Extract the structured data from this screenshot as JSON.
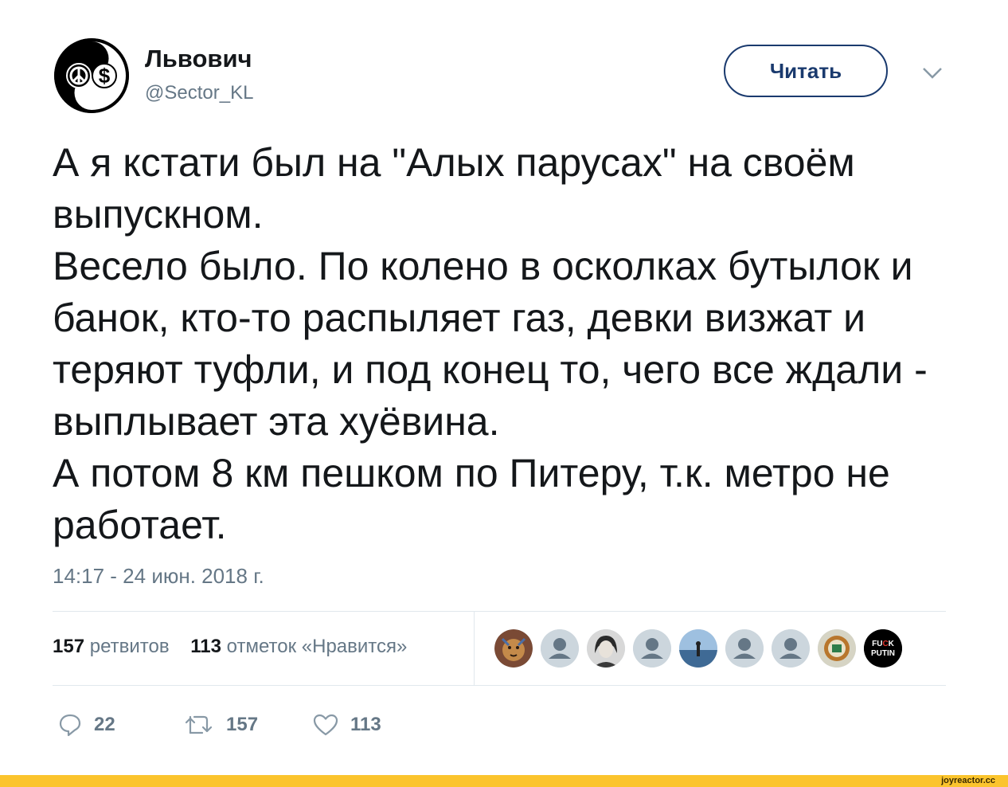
{
  "author": {
    "name": "Львович",
    "handle": "@Sector_KL",
    "avatar_icon": "peace-dollar-yinyang-icon"
  },
  "follow_button": {
    "label": "Читать"
  },
  "menu_icon": "chevron-down-icon",
  "tweet": {
    "paragraphs": [
      "А я кстати был на \"Алых парусах\" на своём выпускном.",
      "Весело было. По колено в осколках бутылок и банок, кто-то распыляет газ, девки визжат и теряют туфли, и под конец то, чего все ждали - выплывает эта хуёвина.",
      "А потом 8 км пешком по Питеру, т.к. метро не работает."
    ],
    "timestamp": "14:17 - 24 июн. 2018 г."
  },
  "stats": {
    "retweets_count": "157",
    "retweets_label": "ретвитов",
    "likes_count": "113",
    "likes_label": "отметок «Нравится»"
  },
  "likers": [
    {
      "icon": "lion-avatar",
      "color": "#8a5a3c"
    },
    {
      "icon": "default-user-avatar",
      "color": "#ccd6dd"
    },
    {
      "icon": "portrait-avatar",
      "color": "#6b6b6b"
    },
    {
      "icon": "default-user-avatar",
      "color": "#ccd6dd"
    },
    {
      "icon": "seascape-avatar",
      "color": "#5a7fa8"
    },
    {
      "icon": "default-user-avatar",
      "color": "#ccd6dd"
    },
    {
      "icon": "default-user-avatar",
      "color": "#ccd6dd"
    },
    {
      "icon": "badge-avatar",
      "color": "#c9c9b8"
    },
    {
      "icon": "fuck-putin-avatar",
      "color": "#000000",
      "text": "FUCK PUTIN"
    }
  ],
  "actions": {
    "reply_count": "22",
    "retweet_count": "157",
    "like_count": "113"
  },
  "footer": {
    "brand": "joyreactor.cc"
  },
  "colors": {
    "accent": "#1a3a6e",
    "muted": "#657786",
    "divider": "#e1e8ed",
    "footer": "#fbc42d"
  }
}
